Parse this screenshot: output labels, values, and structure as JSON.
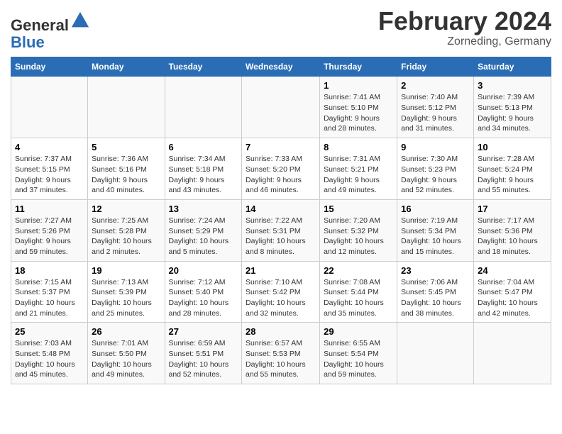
{
  "header": {
    "title": "February 2024",
    "subtitle": "Zorneding, Germany",
    "logo_general": "General",
    "logo_blue": "Blue"
  },
  "days_of_week": [
    "Sunday",
    "Monday",
    "Tuesday",
    "Wednesday",
    "Thursday",
    "Friday",
    "Saturday"
  ],
  "weeks": [
    [
      {
        "day": "",
        "info": ""
      },
      {
        "day": "",
        "info": ""
      },
      {
        "day": "",
        "info": ""
      },
      {
        "day": "",
        "info": ""
      },
      {
        "day": "1",
        "info": "Sunrise: 7:41 AM\nSunset: 5:10 PM\nDaylight: 9 hours\nand 28 minutes."
      },
      {
        "day": "2",
        "info": "Sunrise: 7:40 AM\nSunset: 5:12 PM\nDaylight: 9 hours\nand 31 minutes."
      },
      {
        "day": "3",
        "info": "Sunrise: 7:39 AM\nSunset: 5:13 PM\nDaylight: 9 hours\nand 34 minutes."
      }
    ],
    [
      {
        "day": "4",
        "info": "Sunrise: 7:37 AM\nSunset: 5:15 PM\nDaylight: 9 hours\nand 37 minutes."
      },
      {
        "day": "5",
        "info": "Sunrise: 7:36 AM\nSunset: 5:16 PM\nDaylight: 9 hours\nand 40 minutes."
      },
      {
        "day": "6",
        "info": "Sunrise: 7:34 AM\nSunset: 5:18 PM\nDaylight: 9 hours\nand 43 minutes."
      },
      {
        "day": "7",
        "info": "Sunrise: 7:33 AM\nSunset: 5:20 PM\nDaylight: 9 hours\nand 46 minutes."
      },
      {
        "day": "8",
        "info": "Sunrise: 7:31 AM\nSunset: 5:21 PM\nDaylight: 9 hours\nand 49 minutes."
      },
      {
        "day": "9",
        "info": "Sunrise: 7:30 AM\nSunset: 5:23 PM\nDaylight: 9 hours\nand 52 minutes."
      },
      {
        "day": "10",
        "info": "Sunrise: 7:28 AM\nSunset: 5:24 PM\nDaylight: 9 hours\nand 55 minutes."
      }
    ],
    [
      {
        "day": "11",
        "info": "Sunrise: 7:27 AM\nSunset: 5:26 PM\nDaylight: 9 hours\nand 59 minutes."
      },
      {
        "day": "12",
        "info": "Sunrise: 7:25 AM\nSunset: 5:28 PM\nDaylight: 10 hours\nand 2 minutes."
      },
      {
        "day": "13",
        "info": "Sunrise: 7:24 AM\nSunset: 5:29 PM\nDaylight: 10 hours\nand 5 minutes."
      },
      {
        "day": "14",
        "info": "Sunrise: 7:22 AM\nSunset: 5:31 PM\nDaylight: 10 hours\nand 8 minutes."
      },
      {
        "day": "15",
        "info": "Sunrise: 7:20 AM\nSunset: 5:32 PM\nDaylight: 10 hours\nand 12 minutes."
      },
      {
        "day": "16",
        "info": "Sunrise: 7:19 AM\nSunset: 5:34 PM\nDaylight: 10 hours\nand 15 minutes."
      },
      {
        "day": "17",
        "info": "Sunrise: 7:17 AM\nSunset: 5:36 PM\nDaylight: 10 hours\nand 18 minutes."
      }
    ],
    [
      {
        "day": "18",
        "info": "Sunrise: 7:15 AM\nSunset: 5:37 PM\nDaylight: 10 hours\nand 21 minutes."
      },
      {
        "day": "19",
        "info": "Sunrise: 7:13 AM\nSunset: 5:39 PM\nDaylight: 10 hours\nand 25 minutes."
      },
      {
        "day": "20",
        "info": "Sunrise: 7:12 AM\nSunset: 5:40 PM\nDaylight: 10 hours\nand 28 minutes."
      },
      {
        "day": "21",
        "info": "Sunrise: 7:10 AM\nSunset: 5:42 PM\nDaylight: 10 hours\nand 32 minutes."
      },
      {
        "day": "22",
        "info": "Sunrise: 7:08 AM\nSunset: 5:44 PM\nDaylight: 10 hours\nand 35 minutes."
      },
      {
        "day": "23",
        "info": "Sunrise: 7:06 AM\nSunset: 5:45 PM\nDaylight: 10 hours\nand 38 minutes."
      },
      {
        "day": "24",
        "info": "Sunrise: 7:04 AM\nSunset: 5:47 PM\nDaylight: 10 hours\nand 42 minutes."
      }
    ],
    [
      {
        "day": "25",
        "info": "Sunrise: 7:03 AM\nSunset: 5:48 PM\nDaylight: 10 hours\nand 45 minutes."
      },
      {
        "day": "26",
        "info": "Sunrise: 7:01 AM\nSunset: 5:50 PM\nDaylight: 10 hours\nand 49 minutes."
      },
      {
        "day": "27",
        "info": "Sunrise: 6:59 AM\nSunset: 5:51 PM\nDaylight: 10 hours\nand 52 minutes."
      },
      {
        "day": "28",
        "info": "Sunrise: 6:57 AM\nSunset: 5:53 PM\nDaylight: 10 hours\nand 55 minutes."
      },
      {
        "day": "29",
        "info": "Sunrise: 6:55 AM\nSunset: 5:54 PM\nDaylight: 10 hours\nand 59 minutes."
      },
      {
        "day": "",
        "info": ""
      },
      {
        "day": "",
        "info": ""
      }
    ]
  ]
}
